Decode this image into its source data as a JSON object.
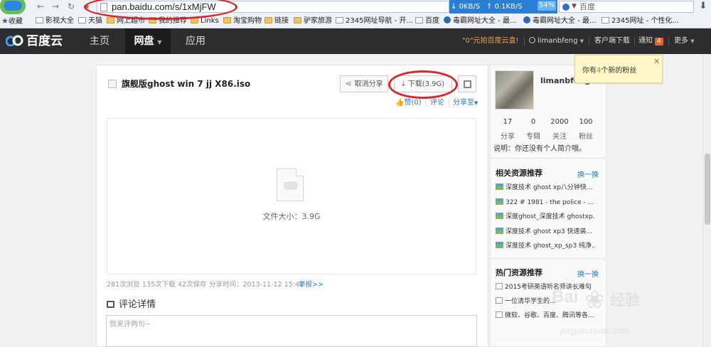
{
  "browser": {
    "url": "pan.baidu.com/s/1xMjFW",
    "download_speed": "0KB/S",
    "upload_speed": "0.1KB/S",
    "percent": "54%",
    "search_placeholder": "百度",
    "bookmarks": [
      {
        "label": "收藏"
      },
      {
        "label": "影视大全"
      },
      {
        "label": "天猫"
      },
      {
        "label": "网上超市"
      },
      {
        "label": "我的推荐"
      },
      {
        "label": "Links"
      },
      {
        "label": "淘宝购物"
      },
      {
        "label": "链接"
      },
      {
        "label": "驴家旅游"
      },
      {
        "label": "2345网址导航 - 开..."
      },
      {
        "label": "百度"
      },
      {
        "label": "毒霸网址大全 - 最..."
      },
      {
        "label": "毒霸网址大全 - 最..."
      },
      {
        "label": "2345网址 - 个性化..."
      }
    ]
  },
  "site": {
    "brand": "百度云",
    "nav": [
      "主页",
      "网盘",
      "应用"
    ],
    "promo": "\"0\"元拍百度云盒!",
    "username": "limanbfeng",
    "client_download": "客户端下载",
    "notifications": "通知",
    "notification_count": "4",
    "more": "更多"
  },
  "file": {
    "title": "旗舰版ghost win 7 jj X86.iso",
    "cancel_share": "取消分享",
    "download": "下载(3.9G)",
    "like": "赞(0)",
    "comment": "评论",
    "share_to": "分享至",
    "size_text": "文件大小：3.9G",
    "stats": {
      "views": "281次浏览",
      "downloads": "135次下载",
      "saves": "42次保存",
      "share_time": "分享时间：2013-11-12 15:42",
      "report": "举报>>"
    }
  },
  "comments": {
    "title": "评论详情",
    "placeholder": "我来评两句~"
  },
  "sidebar": {
    "username": "limanbfeng",
    "stats": [
      {
        "num": "17",
        "label": "分享"
      },
      {
        "num": "0",
        "label": "专辑"
      },
      {
        "num": "2000",
        "label": "关注"
      },
      {
        "num": "100",
        "label": "粉丝"
      }
    ],
    "bio": "说明：你还没有个人简介哦。",
    "related_title": "相关资源推荐",
    "related_more": "换一换",
    "related": [
      "深度技术 ghost xp八分钟快...",
      "322 # 1981 - the police - ...",
      "深度ghost_深度技术 ghostxp...",
      "深度技术 ghost xp3 快速装...",
      "深度技术 ghost_xp_sp3 纯净..."
    ],
    "hot_title": "热门资源推荐",
    "hot_more": "换一换",
    "hot": [
      "2015考研英语听名师讲长难句",
      "一位清华学生的...",
      "微软、谷歌、百度、腾讯等各..."
    ]
  },
  "tooltip": {
    "prefix": "你有",
    "count": "4",
    "suffix": "个新的粉丝",
    "close": "✕"
  },
  "watermark": {
    "brand": "Bai",
    "cn": "经验",
    "url": "jingyan.baidu.com"
  },
  "colors": {
    "annotation_red": "#d7282f",
    "link_blue": "#2d78c4",
    "header_dark": "#2d2d2f",
    "promo_orange": "#f2a23a"
  }
}
